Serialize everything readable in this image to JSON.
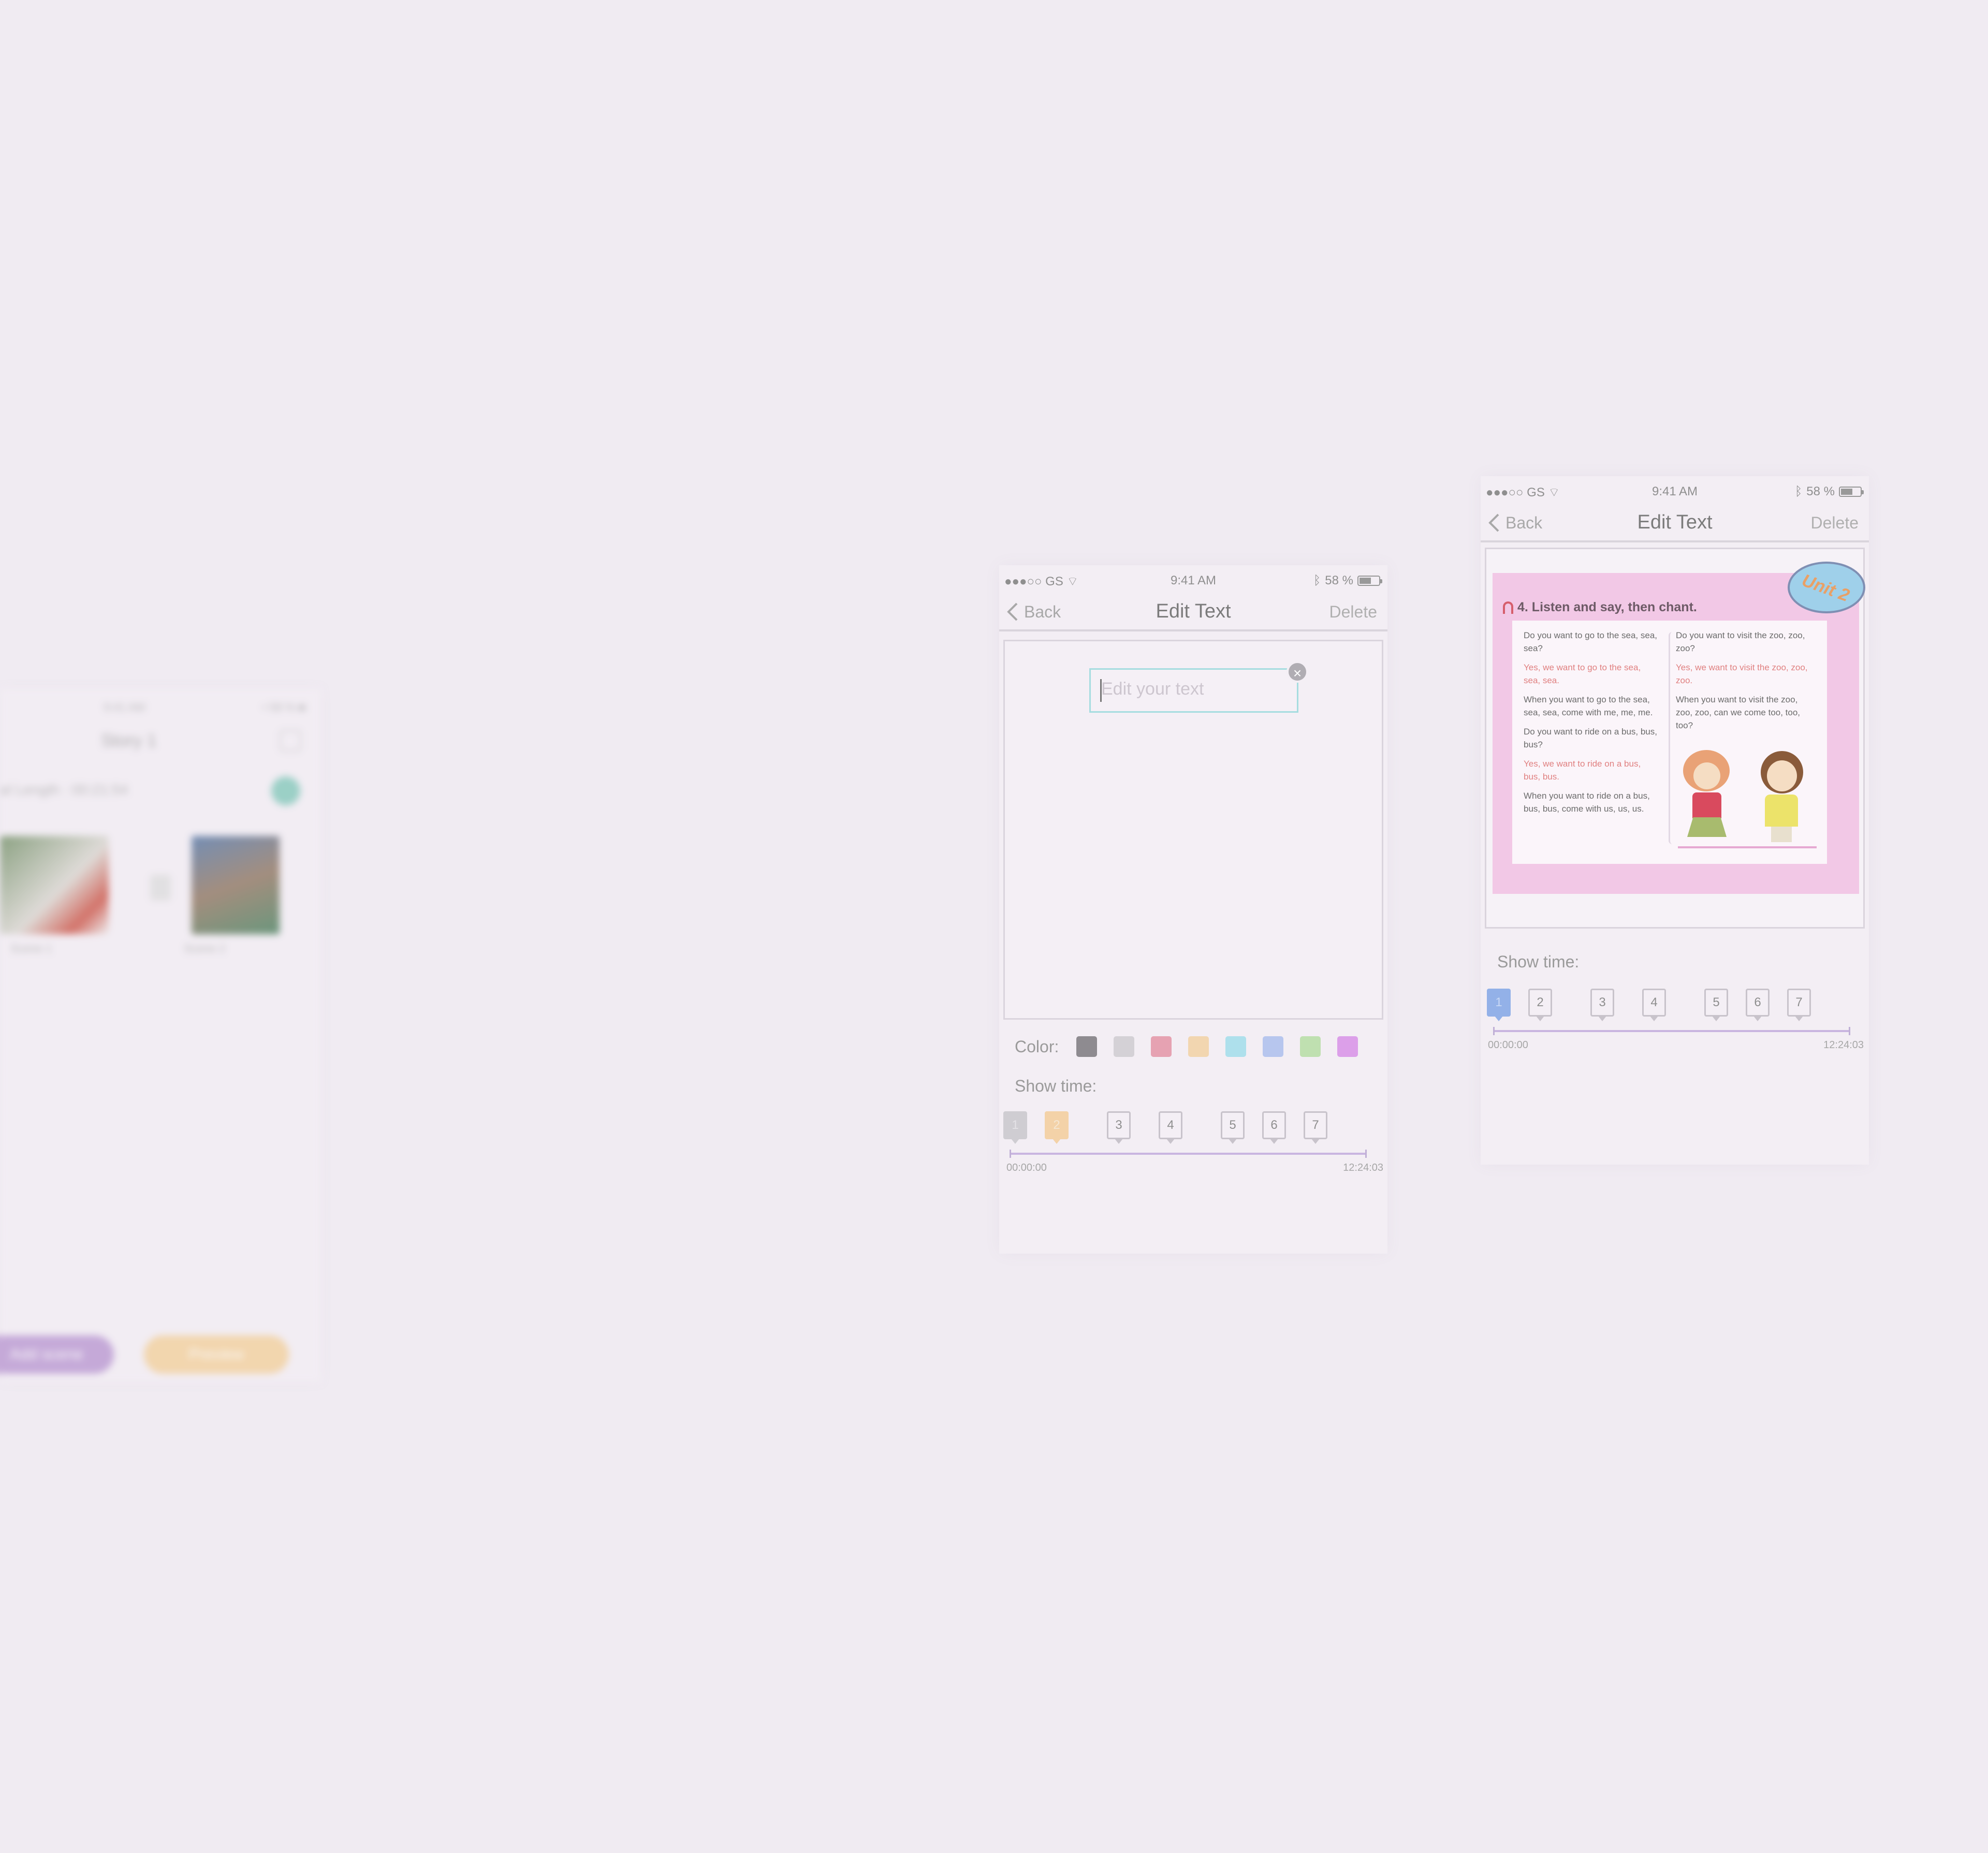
{
  "left_phone": {
    "status_time": "9:41 AM",
    "status_right": "• 58 % ■",
    "title": "Story 1",
    "length_label": "al Length : 00:21:54",
    "scenes": [
      {
        "label": "Scene 1"
      },
      {
        "label": "Scene 2"
      }
    ],
    "add_scene_label": "Add scene",
    "preview_label": "Preview"
  },
  "mid_phone": {
    "status": {
      "carrier": "●●●○○ GS",
      "time": "9:41 AM",
      "battery": "58 %"
    },
    "nav": {
      "back": "Back",
      "title": "Edit Text",
      "delete": "Delete"
    },
    "text_input": {
      "placeholder": "Edit your text",
      "value": ""
    },
    "clear_icon": "close-icon",
    "color_label": "Color:",
    "colors": [
      "#8e8b90",
      "#d4d1d6",
      "#e6a2b2",
      "#f2d6b0",
      "#aee0ec",
      "#b7c6ee",
      "#bfe0b0",
      "#dc9fe9"
    ],
    "show_time_label": "Show time:",
    "timeline": {
      "start": "00:00:00",
      "end": "12:24:03",
      "markers": [
        {
          "label": "1",
          "state": "gray"
        },
        {
          "label": "2",
          "state": "orange"
        },
        {
          "label": "3",
          "state": "normal"
        },
        {
          "label": "4",
          "state": "normal"
        },
        {
          "label": "5",
          "state": "normal"
        },
        {
          "label": "6",
          "state": "normal"
        },
        {
          "label": "7",
          "state": "normal"
        }
      ]
    }
  },
  "right_phone": {
    "status": {
      "carrier": "●●●○○ GS",
      "time": "9:41 AM",
      "battery": "58 %"
    },
    "nav": {
      "back": "Back",
      "title": "Edit Text",
      "delete": "Delete"
    },
    "page": {
      "heading": "4. Listen and say, then chant.",
      "badge": "Unit 2",
      "left_column": [
        {
          "text": "Do you want to go to the sea, sea, sea?",
          "red": false
        },
        {
          "text": "Yes, we want to go to the sea, sea, sea.",
          "red": true
        },
        {
          "text": "When you want to go to the sea, sea, sea, come with me, me, me.",
          "red": false
        },
        {
          "text": "Do you want to ride on a bus, bus, bus?",
          "red": false
        },
        {
          "text": "Yes, we want to ride on a bus, bus, bus.",
          "red": true
        },
        {
          "text": "When you want to ride on a bus, bus, bus, come with us, us, us.",
          "red": false
        }
      ],
      "right_column": [
        {
          "text": "Do you want to visit the zoo, zoo, zoo?",
          "red": false
        },
        {
          "text": "Yes, we want to visit the zoo, zoo, zoo.",
          "red": true
        },
        {
          "text": "When you want to visit the zoo, zoo, zoo, can we come too, too, too?",
          "red": false
        }
      ]
    },
    "show_time_label": "Show time:",
    "timeline": {
      "start": "00:00:00",
      "end": "12:24:03",
      "markers": [
        {
          "label": "1",
          "state": "blue"
        },
        {
          "label": "2",
          "state": "normal"
        },
        {
          "label": "3",
          "state": "normal"
        },
        {
          "label": "4",
          "state": "normal"
        },
        {
          "label": "5",
          "state": "normal"
        },
        {
          "label": "6",
          "state": "normal"
        },
        {
          "label": "7",
          "state": "normal"
        }
      ]
    }
  }
}
